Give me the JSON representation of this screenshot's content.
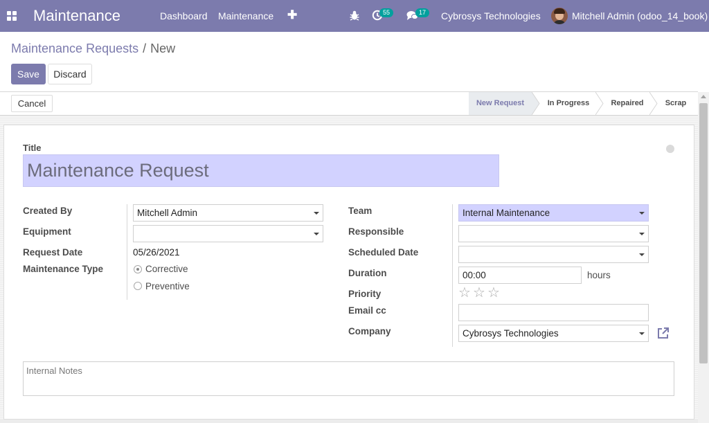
{
  "navbar": {
    "app_name": "Maintenance",
    "menu": [
      "Dashboard",
      "Maintenance"
    ],
    "activity_count": "55",
    "message_count": "17",
    "company": "Cybrosys Technologies",
    "user": "Mitchell Admin (odoo_14_book)",
    "icons": [
      "apps-icon",
      "plus-icon",
      "bug-icon",
      "clock-icon",
      "chat-icon"
    ],
    "colors": {
      "navbar": "#7c7bad",
      "badge": "#00a09d"
    }
  },
  "breadcrumb": {
    "parent": "Maintenance Requests",
    "separator": "/",
    "current": "New"
  },
  "buttons": {
    "save": "Save",
    "discard": "Discard",
    "cancel": "Cancel"
  },
  "stages": [
    {
      "label": "New Request",
      "active": true
    },
    {
      "label": "In Progress",
      "active": false
    },
    {
      "label": "Repaired",
      "active": false
    },
    {
      "label": "Scrap",
      "active": false
    }
  ],
  "form": {
    "title_label": "Title",
    "title_value": "Maintenance Request",
    "left": {
      "created_by": {
        "label": "Created By",
        "value": "Mitchell Admin"
      },
      "equipment": {
        "label": "Equipment",
        "value": ""
      },
      "request_date": {
        "label": "Request Date",
        "value": "05/26/2021"
      },
      "maintenance_type": {
        "label": "Maintenance Type",
        "options": [
          {
            "label": "Corrective",
            "checked": true
          },
          {
            "label": "Preventive",
            "checked": false
          }
        ]
      }
    },
    "right": {
      "team": {
        "label": "Team",
        "value": "Internal Maintenance"
      },
      "responsible": {
        "label": "Responsible",
        "value": ""
      },
      "scheduled_date": {
        "label": "Scheduled Date",
        "value": ""
      },
      "duration": {
        "label": "Duration",
        "value": "00:00",
        "unit": "hours"
      },
      "priority": {
        "label": "Priority",
        "stars": 3,
        "filled": 0
      },
      "email_cc": {
        "label": "Email cc",
        "value": ""
      },
      "company": {
        "label": "Company",
        "value": "Cybrosys Technologies"
      }
    },
    "notes_placeholder": "Internal Notes"
  }
}
